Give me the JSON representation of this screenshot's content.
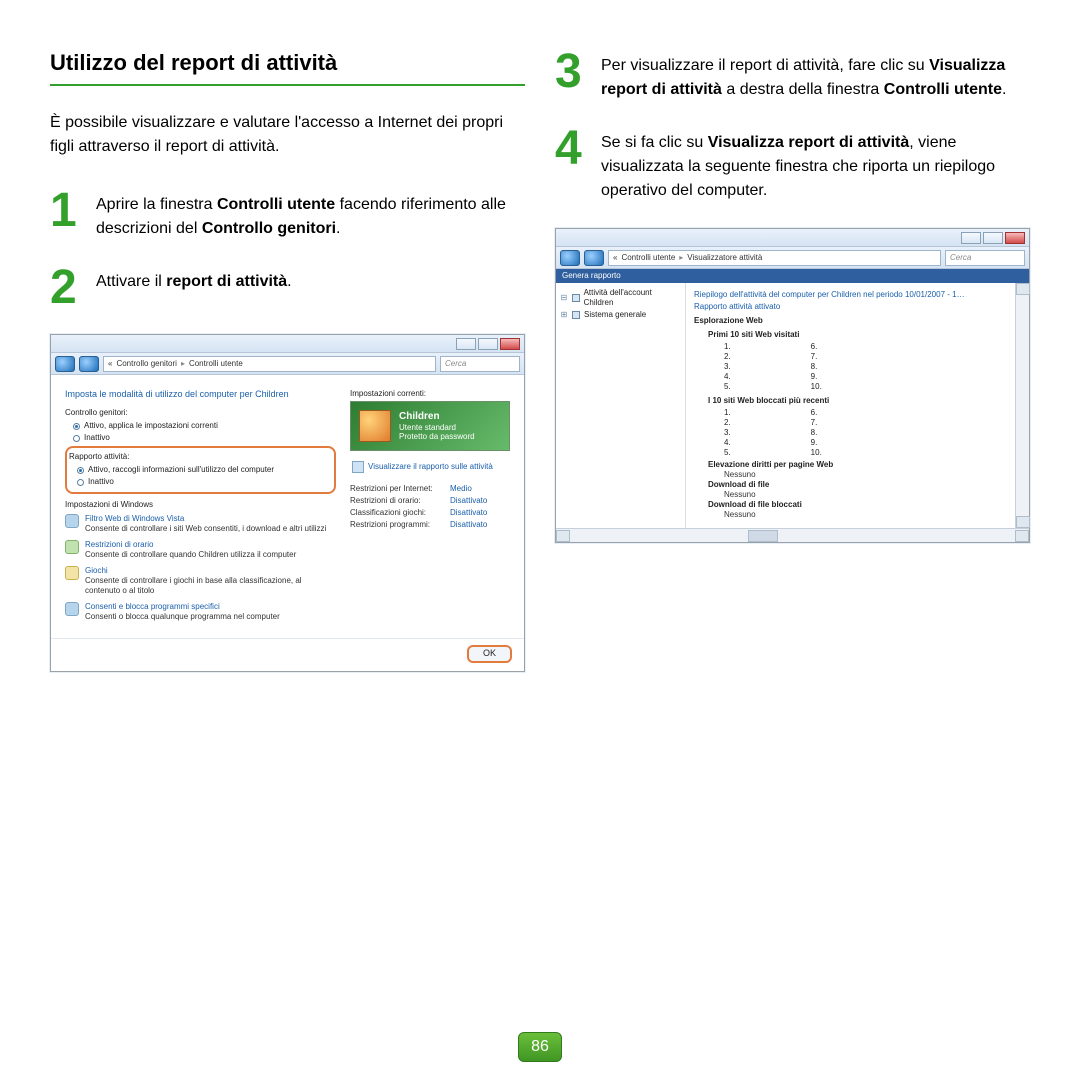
{
  "page_number": "86",
  "section_title": "Utilizzo del report di attività",
  "intro": "È possibile visualizzare e valutare l'accesso a Internet dei propri figli attraverso il report di attività.",
  "steps": {
    "s1": {
      "num": "1",
      "pre": "Aprire la finestra ",
      "b1": "Controlli utente",
      "mid": " facendo riferimento alle descrizioni del ",
      "b2": "Controllo genitori",
      "post": "."
    },
    "s2": {
      "num": "2",
      "pre": "Attivare il ",
      "b1": "report di attività",
      "post": "."
    },
    "s3": {
      "num": "3",
      "pre": "Per visualizzare il report di attività, fare clic su ",
      "b1": "Visualizza report di attività",
      "mid": " a destra della finestra ",
      "b2": "Controlli utente",
      "post": "."
    },
    "s4": {
      "num": "4",
      "pre": "Se si fa clic su ",
      "b1": "Visualizza report di attività",
      "post": ", viene visualizzata la seguente finestra che riporta un riepilogo operativo del computer."
    }
  },
  "win1": {
    "breadcrumb_a": "Controllo genitori",
    "breadcrumb_b": "Controlli utente",
    "search_ph": "Cerca",
    "heading": "Imposta le modalità di utilizzo del computer per Children",
    "grp_parent": "Controllo genitori:",
    "radio_parent_on": "Attivo, applica le impostazioni correnti",
    "radio_off": "Inattivo",
    "grp_report": "Rapporto attività:",
    "radio_report_on": "Attivo, raccogli informazioni sull'utilizzo del computer",
    "sub_h": "Impostazioni di Windows",
    "s_web_t": "Filtro Web di Windows Vista",
    "s_web_d": "Consente di controllare i siti Web consentiti, i download e altri utilizzi",
    "s_time_t": "Restrizioni di orario",
    "s_time_d": "Consente di controllare quando Children utilizza il computer",
    "s_games_t": "Giochi",
    "s_games_d": "Consente di controllare i giochi in base alla classificazione, al contenuto o al titolo",
    "s_prog_t": "Consenti e blocca programmi specifici",
    "s_prog_d": "Consenti o blocca qualunque programma nel computer",
    "right_h": "Impostazioni correnti:",
    "user_name": "Children",
    "user_type": "Utente standard",
    "user_pw": "Protetto da password",
    "view_link": "Visualizzare il rapporto sulle attività",
    "tbl": {
      "k1": "Restrizioni per Internet:",
      "v1": "Medio",
      "k2": "Restrizioni di orario:",
      "v2": "Disattivato",
      "k3": "Classificazioni giochi:",
      "v3": "Disattivato",
      "k4": "Restrizioni programmi:",
      "v4": "Disattivato"
    },
    "ok": "OK"
  },
  "win2": {
    "breadcrumb_a": "Controlli utente",
    "breadcrumb_b": "Visualizzatore attività",
    "search_ph": "Cerca",
    "band": "Genera rapporto",
    "tree_a": "Attività dell'account Children",
    "tree_b": "Sistema generale",
    "rep_title": "Riepilogo dell'attività del computer per Children nel periodo 10/01/2007 - 1…",
    "rep_state": "Rapporto attività attivato",
    "h_web": "Esplorazione Web",
    "h_top": "Primi 10 siti Web visitati",
    "h_blocked": "I 10 siti Web bloccati più recenti",
    "h_elev": "Elevazione diritti per pagine Web",
    "h_dlfile": "Download di file",
    "h_dlblk": "Download di file bloccati",
    "none": "Nessuno",
    "nums_a": [
      "1.",
      "2.",
      "3.",
      "4.",
      "5."
    ],
    "nums_b": [
      "6.",
      "7.",
      "8.",
      "9.",
      "10."
    ]
  }
}
